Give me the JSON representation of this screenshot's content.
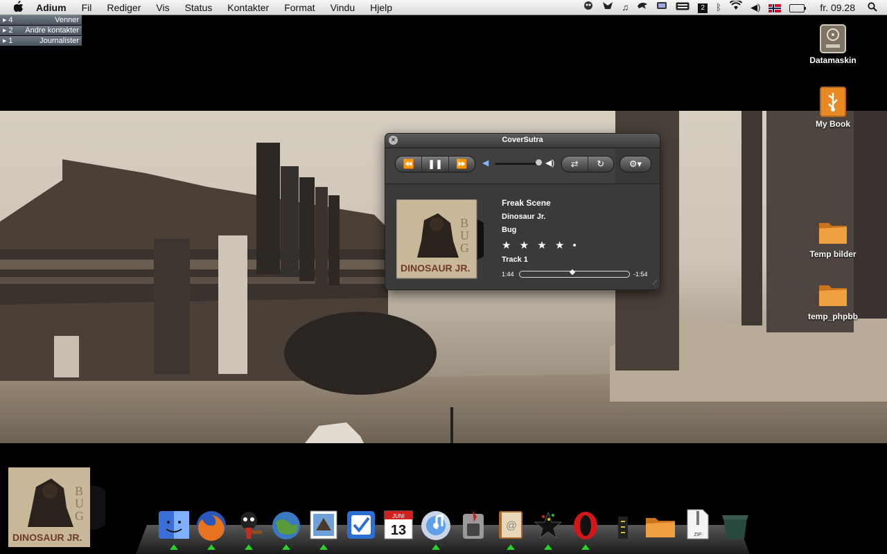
{
  "menubar": {
    "app_name": "Adium",
    "menus": [
      "Fil",
      "Rediger",
      "Vis",
      "Status",
      "Kontakter",
      "Format",
      "Vindu",
      "Hjelp"
    ],
    "clock": "fr. 09.28",
    "badge_number": "2"
  },
  "adium": {
    "groups": [
      {
        "count": "4",
        "name": "Venner"
      },
      {
        "count": "2",
        "name": "Andre kontakter"
      },
      {
        "count": "1",
        "name": "Journalister"
      }
    ]
  },
  "desktop": {
    "icons": [
      {
        "label": "Datamaskin",
        "icon": "hard-drive-icon"
      },
      {
        "label": "My Book",
        "icon": "usb-drive-icon"
      },
      {
        "label": "Temp bilder",
        "icon": "folder-icon"
      },
      {
        "label": "temp_phpbb",
        "icon": "folder-icon"
      }
    ]
  },
  "coversutra": {
    "title": "CoverSutra",
    "song": "Freak Scene",
    "artist": "Dinosaur Jr.",
    "album": "Bug",
    "rating_stars": "★ ★ ★ ★ •",
    "rating": 4,
    "track": "Track 1",
    "elapsed": "1:44",
    "remaining": "-1:54",
    "progress": 0.48,
    "volume": 0.95,
    "cover_text": "DINOSAUR JR."
  },
  "dock": {
    "items": [
      "finder-icon",
      "firefox-icon",
      "adium-icon",
      "world-clock-icon",
      "mail-stamp-icon",
      "things-icon",
      "calendar-icon",
      "itunes-icon",
      "system-preferences-icon",
      "address-book-icon",
      "starburst-icon",
      "opera-icon",
      "terminal-icon",
      "folder-stack-icon",
      "zip-icon",
      "trash-icon"
    ],
    "calendar_month": "JUNI",
    "calendar_day": "13",
    "zip_label": "ZIP"
  },
  "colors": {
    "run_indicator": "#2bd12b",
    "folder": "#e8902a"
  }
}
